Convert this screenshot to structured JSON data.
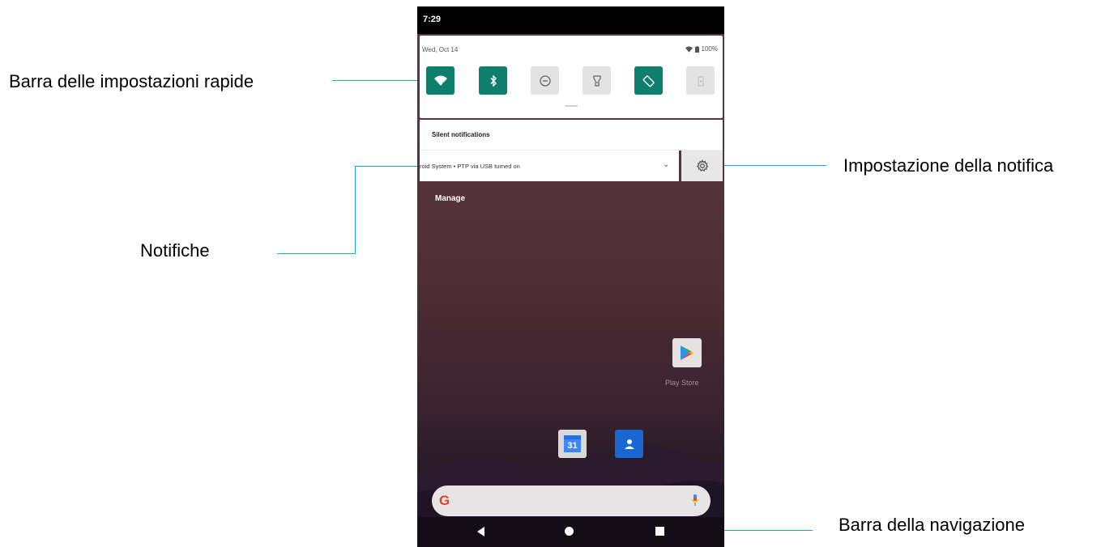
{
  "callouts": {
    "quick_settings": "Barra delle impostazioni rapide",
    "notification_setting": "Impostazione della notifica",
    "notifications": "Notifiche",
    "navigation_bar": "Barra della navigazione"
  },
  "status_bar": {
    "time": "7:29"
  },
  "quick_settings": {
    "date": "Wed, Oct 14",
    "battery": "100%",
    "tiles": [
      {
        "icon": "wifi-icon",
        "state": "on"
      },
      {
        "icon": "bluetooth-icon",
        "state": "on"
      },
      {
        "icon": "do-not-disturb-icon",
        "state": "off"
      },
      {
        "icon": "flashlight-icon",
        "state": "off"
      },
      {
        "icon": "auto-rotate-icon",
        "state": "on"
      },
      {
        "icon": "battery-saver-icon",
        "state": "off"
      }
    ],
    "accent_color": "#0f7f6d"
  },
  "notifications": {
    "section_header": "Silent notifications",
    "item_text": "roid System • PTP via USB turned on",
    "manage_label": "Manage"
  },
  "home": {
    "play_store_label": "Play Store",
    "calendar_day": "31",
    "search_logo": "G"
  },
  "navigation": {
    "buttons": [
      "back-icon",
      "home-icon",
      "recents-icon"
    ]
  }
}
